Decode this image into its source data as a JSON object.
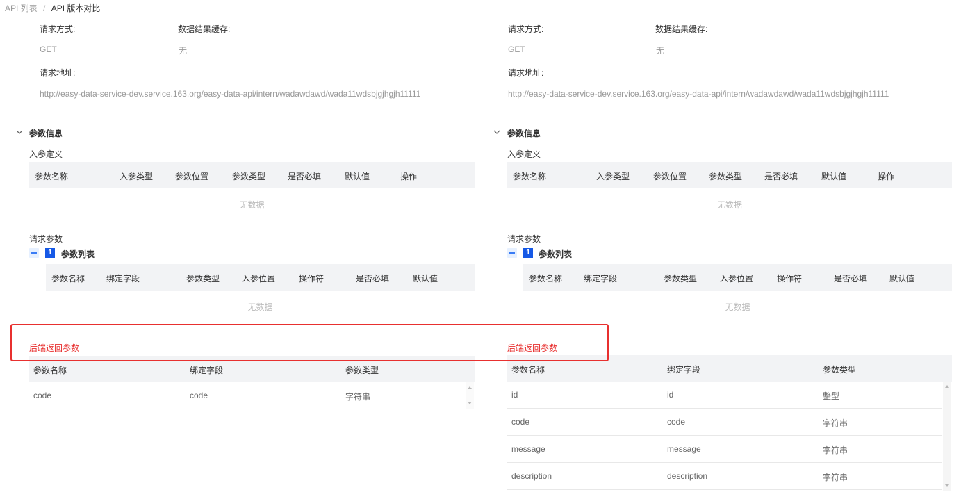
{
  "breadcrumb": {
    "parent": "API 列表",
    "separator": "/",
    "current": "API 版本对比"
  },
  "panels": [
    {
      "request_method_label": "请求方式:",
      "request_method": "GET",
      "cache_label": "数据结果缓存:",
      "cache_value": "无",
      "request_url_label": "请求地址:",
      "request_url": "http://easy-data-service-dev.service.163.org/easy-data-api/intern/wadawdawd/wada11wdsbjgjhgjh11111",
      "param_info_title": "参数信息",
      "input_def_title": "入参定义",
      "input_def_headers": [
        "参数名称",
        "入参类型",
        "参数位置",
        "参数类型",
        "是否必填",
        "默认值",
        "操作"
      ],
      "input_def_empty": "无数据",
      "request_params_title": "请求参数",
      "param_list_badge": "1",
      "param_list_title": "参数列表",
      "param_list_headers": [
        "参数名称",
        "绑定字段",
        "参数类型",
        "入参位置",
        "操作符",
        "是否必填",
        "默认值"
      ],
      "param_list_empty": "无数据",
      "backend_title": "后端返回参数",
      "backend_headers": [
        "参数名称",
        "绑定字段",
        "参数类型"
      ],
      "backend_rows": [
        [
          "code",
          "code",
          "字符串"
        ]
      ]
    },
    {
      "request_method_label": "请求方式:",
      "request_method": "GET",
      "cache_label": "数据结果缓存:",
      "cache_value": "无",
      "request_url_label": "请求地址:",
      "request_url": "http://easy-data-service-dev.service.163.org/easy-data-api/intern/wadawdawd/wada11wdsbjgjhgjh11111",
      "param_info_title": "参数信息",
      "input_def_title": "入参定义",
      "input_def_headers": [
        "参数名称",
        "入参类型",
        "参数位置",
        "参数类型",
        "是否必填",
        "默认值",
        "操作"
      ],
      "input_def_empty": "无数据",
      "request_params_title": "请求参数",
      "param_list_badge": "1",
      "param_list_title": "参数列表",
      "param_list_headers": [
        "参数名称",
        "绑定字段",
        "参数类型",
        "入参位置",
        "操作符",
        "是否必填",
        "默认值"
      ],
      "param_list_empty": "无数据",
      "backend_title": "后端返回参数",
      "backend_headers": [
        "参数名称",
        "绑定字段",
        "参数类型"
      ],
      "backend_rows": [
        [
          "id",
          "id",
          "整型"
        ],
        [
          "code",
          "code",
          "字符串"
        ],
        [
          "message",
          "message",
          "字符串"
        ],
        [
          "description",
          "description",
          "字符串"
        ]
      ]
    }
  ],
  "colors": {
    "highlight_box": "#e8302f",
    "badge": "#1659e6",
    "header_bg": "#f2f3f5"
  },
  "icons": {
    "collapse": "chevron-down-icon",
    "list_toggle": "minus-square-icon"
  }
}
